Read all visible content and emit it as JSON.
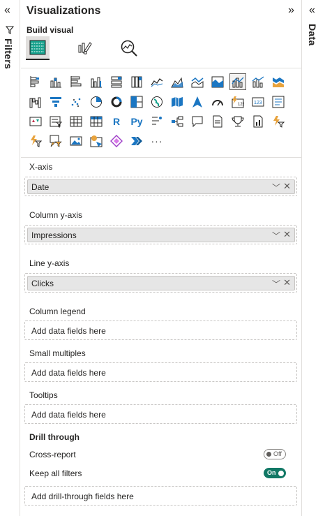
{
  "filters_pane": {
    "label": "Filters"
  },
  "data_pane": {
    "label": "Data"
  },
  "visualizations": {
    "title": "Visualizations",
    "build_visual_label": "Build visual",
    "more_label": "···",
    "r_label": "R",
    "py_label": "Py"
  },
  "fields": {
    "x_axis": {
      "label": "X-axis",
      "value": "Date"
    },
    "column_y_axis": {
      "label": "Column y-axis",
      "value": "Impressions"
    },
    "line_y_axis": {
      "label": "Line y-axis",
      "value": "Clicks"
    },
    "column_legend": {
      "label": "Column legend",
      "placeholder": "Add data fields here"
    },
    "small_multiples": {
      "label": "Small multiples",
      "placeholder": "Add data fields here"
    },
    "tooltips": {
      "label": "Tooltips",
      "placeholder": "Add data fields here"
    }
  },
  "drill_through": {
    "label": "Drill through",
    "cross_report": {
      "label": "Cross-report",
      "state": "Off"
    },
    "keep_all_filters": {
      "label": "Keep all filters",
      "state": "On"
    },
    "placeholder": "Add drill-through fields here"
  },
  "colors": {
    "accent": "#117865",
    "blue": "#1b76c2",
    "teal": "#15a08b"
  }
}
